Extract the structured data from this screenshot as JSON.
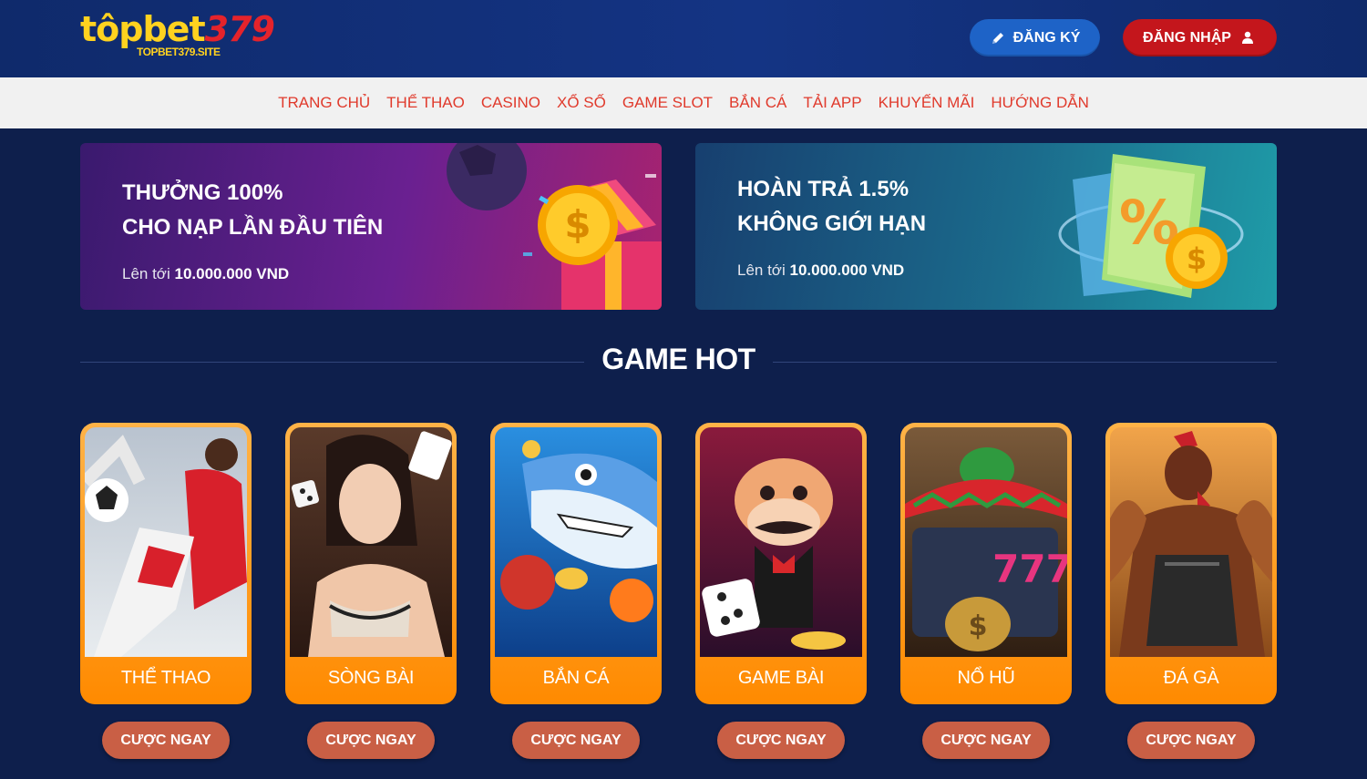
{
  "header": {
    "logo_main_a": "tôp",
    "logo_main_b": "bet",
    "logo_main_c": "379",
    "logo_sub": "TOPBET379.SITE",
    "register_label": "ĐĂNG KÝ",
    "login_label": "ĐĂNG NHẬP"
  },
  "nav": [
    {
      "label": "TRANG CHỦ"
    },
    {
      "label": "THỂ THAO"
    },
    {
      "label": "CASINO"
    },
    {
      "label": "XỔ SỐ"
    },
    {
      "label": "GAME SLOT"
    },
    {
      "label": "BẮN CÁ"
    },
    {
      "label": "TẢI APP"
    },
    {
      "label": "KHUYẾN MÃI"
    },
    {
      "label": "HƯỚNG DẪN"
    }
  ],
  "banners": [
    {
      "line1": "THƯỞNG 100%",
      "line2": "CHO NẠP LẦN ĐẦU TIÊN",
      "sub_prefix": "Lên tới",
      "sub_value": "10.000.000 VND"
    },
    {
      "line1": "HOÀN TRẢ 1.5%",
      "line2": "KHÔNG GIỚI HẠN",
      "sub_prefix": "Lên tới",
      "sub_value": "10.000.000 VND"
    }
  ],
  "section_title": "GAME HOT",
  "games": [
    {
      "label": "THỂ THAO",
      "cta": "CƯỢC NGAY"
    },
    {
      "label": "SÒNG BÀI",
      "cta": "CƯỢC NGAY"
    },
    {
      "label": "BẮN CÁ",
      "cta": "CƯỢC NGAY"
    },
    {
      "label": "GAME BÀI",
      "cta": "CƯỢC NGAY"
    },
    {
      "label": "NỔ HŨ",
      "cta": "CƯỢC NGAY"
    },
    {
      "label": "ĐÁ GÀ",
      "cta": "CƯỢC NGAY"
    }
  ],
  "colors": {
    "header_bg": "#143484",
    "nav_text": "#e03a2c",
    "register_bg": "#1e63c7",
    "login_bg": "#c4161c",
    "card_frame": "#ff8a00",
    "cta_bg": "#c95f45",
    "page_bg": "#0e1f4c"
  }
}
